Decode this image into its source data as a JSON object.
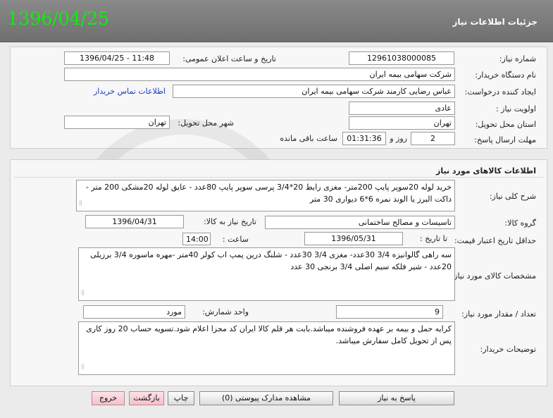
{
  "header": {
    "date": "1396/04/25",
    "title": "جزئیات اطلاعات نیاز"
  },
  "info": {
    "need_number_label": "شماره نیاز:",
    "need_number": "12961038000085",
    "announce_label": "تاریخ و ساعت اعلان عمومی:",
    "announce_value": "1396/04/25 - 11:48",
    "buyer_label": "نام دستگاه خریدار:",
    "buyer": "شرکت سهامی بیمه ایران",
    "creator_label": "ایجاد کننده درخواست:",
    "creator": "عباس رضایی کارمند شرکت سهامی بیمه ایران",
    "contact_link": "اطلاعات تماس خریدار",
    "priority_label": "اولویت نیاز :",
    "priority": "عادی",
    "province_label": "استان محل تحویل:",
    "province": "تهران",
    "city_label": "شهر محل تحویل:",
    "city": "تهران",
    "deadline_label": "مهلت ارسال پاسخ:",
    "days": "2",
    "days_label": "روز و",
    "time_left": "01:31:36",
    "time_left_label": "ساعت باقی مانده"
  },
  "goods": {
    "section_title": "اطلاعات کالاهای مورد نیاز",
    "summary_label": "شرح کلی نیاز:",
    "summary": "خرید لوله 20سوپر پایپ 200متر- مغزی رابط 20*3/4 پرسی سوپر پایپ 80عدد - عایق لوله 20مشکی 200 متر - داکت البرز یا الوند نمره 6*6 دیواری 30 متر",
    "group_label": "گروه کالا:",
    "group": "تاسیسات و مصالح ساختمانی",
    "need_date_label": "تاریخ نیاز به کالا:",
    "need_date": "1396/04/31",
    "validity_label": "حداقل تاریخ اعتبار قیمت:",
    "until_label": "تا تاریخ :",
    "validity_date": "1396/05/31",
    "hour_label": "ساعت :",
    "validity_time": "14:00",
    "specs_label": "مشخصات کالای مورد نیاز:",
    "specs": "سه راهی گالوانیزه 3/4 30عدد- مغزی 3/4 30عدد - شلنگ درین پمپ اب کولر 40متر -مهره ماسوره 3/4 برزیلی 20عدد - شیر فلکه سیم اصلی 3/4 برنجی 30 عدد",
    "qty_label": "تعداد / مقدار مورد نیاز:",
    "qty": "9",
    "unit_label": "واحد شمارش:",
    "unit": "مورد",
    "notes_label": "توضیحات خریدار:",
    "notes": "کرایه حمل و بیمه بر عهده فروشنده میباشد.بابت هر قلم کالا ایران کد مجزا اعلام شود.تسویه حساب 20 روز کاری پس از تحویل کامل سفارش میباشد."
  },
  "buttons": {
    "reply": "پاسخ به نیاز",
    "attachments": "مشاهده مدارک پیوستی (0)",
    "print": "چاپ",
    "back": "بازگشت",
    "exit": "خروج"
  }
}
